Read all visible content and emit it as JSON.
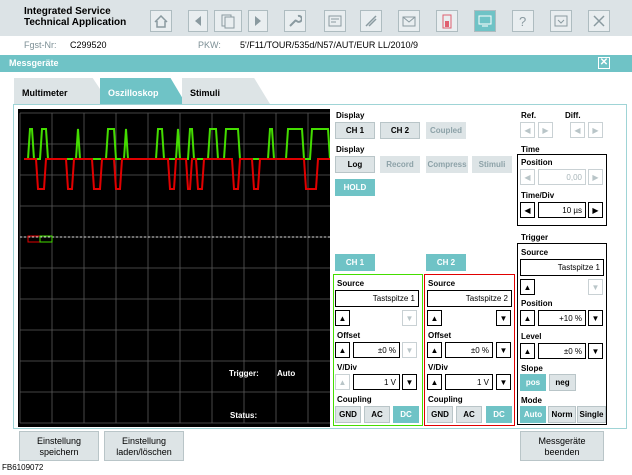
{
  "app": {
    "title": "Integrated Service\nTechnical Application"
  },
  "vehicle": {
    "fgst_label": "Fgst-Nr:",
    "fgst_value": "C299520",
    "pkw_label": "PKW:",
    "pkw_value": "5'/F11/TOUR/535d/N57/AUT/EUR LL/2010/9"
  },
  "bar": {
    "title": "Messgeräte",
    "close": "✕"
  },
  "tabs": [
    {
      "label": "Multimeter"
    },
    {
      "label": "Oszilloskop"
    },
    {
      "label": "Stimuli"
    }
  ],
  "scope": {
    "trigger_label": "Trigger:",
    "trigger_value": "Auto",
    "status_label": "Status:",
    "ch1_color": "#e00000",
    "ch2_color": "#44dd00"
  },
  "display1": {
    "title": "Display",
    "ch1": "CH 1",
    "ch2": "CH 2",
    "coupled": "Coupled"
  },
  "display2": {
    "title": "Display",
    "log": "Log",
    "record": "Record",
    "compress": "Compress",
    "stimuli": "Stimuli",
    "hold": "HOLD"
  },
  "ref": {
    "ref_label": "Ref.",
    "diff_label": "Diff."
  },
  "time": {
    "title": "Time",
    "position_label": "Position",
    "position_value": "0,00",
    "timediv_label": "Time/Div",
    "timediv_value": "10 µs"
  },
  "trigger": {
    "title": "Trigger",
    "source_label": "Source",
    "source_value": "Tastspitze 1",
    "position_label": "Position",
    "position_value": "+10 %",
    "level_label": "Level",
    "level_value": "±0 %",
    "slope_label": "Slope",
    "slope_pos": "pos",
    "slope_neg": "neg",
    "mode_label": "Mode",
    "mode_auto": "Auto",
    "mode_norm": "Norm",
    "mode_single": "Single"
  },
  "ch1": {
    "title": "CH 1",
    "source_label": "Source",
    "source_value": "Tastspitze 1",
    "offset_label": "Offset",
    "offset_value": "±0 %",
    "vdiv_label": "V/Div",
    "vdiv_value": "1 V",
    "coupling_label": "Coupling",
    "gnd": "GND",
    "ac": "AC",
    "dc": "DC"
  },
  "ch2": {
    "title": "CH 2",
    "source_label": "Source",
    "source_value": "Tastspitze 2",
    "offset_label": "Offset",
    "offset_value": "±0 %",
    "vdiv_label": "V/Div",
    "vdiv_value": "1 V",
    "coupling_label": "Coupling",
    "gnd": "GND",
    "ac": "AC",
    "dc": "DC"
  },
  "footer": {
    "save": "Einstellung\nspeichern",
    "load": "Einstellung\nladen/löschen",
    "end": "Messgeräte\nbeenden",
    "figure_id": "FB6109072"
  }
}
